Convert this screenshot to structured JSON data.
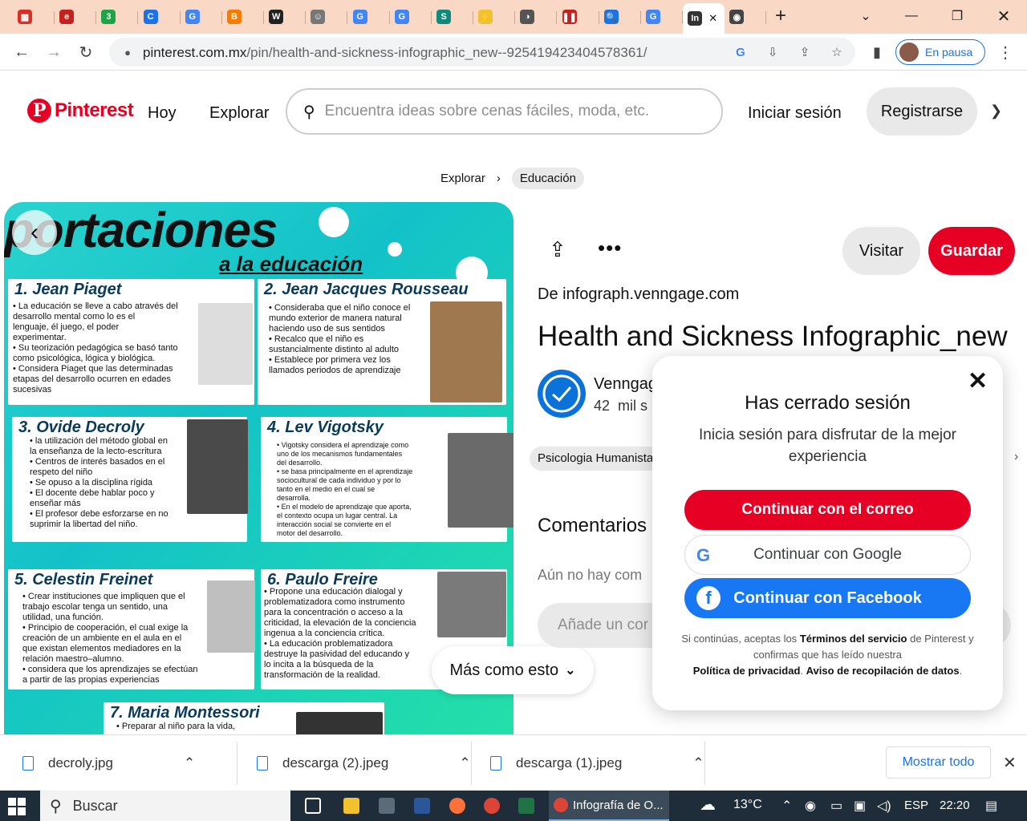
{
  "browser": {
    "tabs": [
      {
        "name": "tab-1",
        "color": "#d93025",
        "glyph": "▦"
      },
      {
        "name": "tab-2",
        "color": "#c5221f",
        "glyph": "e"
      },
      {
        "name": "tab-3",
        "color": "#1ea446",
        "glyph": "3"
      },
      {
        "name": "tab-4",
        "color": "#1a73e8",
        "glyph": "C"
      },
      {
        "name": "tab-5",
        "color": "#4285f4",
        "glyph": "G"
      },
      {
        "name": "tab-6",
        "color": "#f57c00",
        "glyph": "B"
      },
      {
        "name": "tab-7",
        "color": "#222222",
        "glyph": "W"
      },
      {
        "name": "tab-8",
        "color": "#777777",
        "glyph": "☺"
      },
      {
        "name": "tab-9",
        "color": "#4285f4",
        "glyph": "G"
      },
      {
        "name": "tab-10",
        "color": "#4285f4",
        "glyph": "G"
      },
      {
        "name": "tab-11",
        "color": "#0e8a7a",
        "glyph": "S"
      },
      {
        "name": "tab-12",
        "color": "#f2c12e",
        "glyph": "⚡"
      },
      {
        "name": "tab-13",
        "color": "#555555",
        "glyph": "◑"
      },
      {
        "name": "tab-14",
        "color": "#c5221f",
        "glyph": "❚❚"
      },
      {
        "name": "tab-15",
        "color": "#1a73e8",
        "glyph": "🔍"
      },
      {
        "name": "tab-16",
        "color": "#4285f4",
        "glyph": "G"
      },
      {
        "name": "tab-active",
        "color": "#333333",
        "glyph": "In"
      },
      {
        "name": "tab-18",
        "color": "#444444",
        "glyph": "◉"
      }
    ],
    "url_host": "pinterest.com.mx",
    "url_path": "/pin/health-and-sickness-infographic_new--925419423404578361/",
    "profile_label": "En pausa"
  },
  "pinterest": {
    "logo_text": "Pinterest",
    "nav_today": "Hoy",
    "nav_explore": "Explorar",
    "search_placeholder": "Encuentra ideas sobre cenas fáciles, moda, etc.",
    "login": "Iniciar sesión",
    "signup": "Registrarse",
    "breadcrumb": [
      "Explorar",
      "Educación"
    ],
    "more_like_this": "Más como esto",
    "visit": "Visitar",
    "save": "Guardar",
    "source_prefix": "De",
    "source_domain": "infograph.venngage.com",
    "pin_title": "Health and Sickness Infographic_new",
    "author_name": "Venngag",
    "author_followers_num": "42",
    "author_followers_text": "mil s",
    "tag": "Psicologia Humanista",
    "comments_heading": "Comentarios",
    "no_comments": "Aún no hay com",
    "add_comment_placeholder": "Añade un cor"
  },
  "infographic": {
    "title": "portaciones",
    "subtitle": "a la educación",
    "cards": [
      {
        "heading": "1. Jean Piaget",
        "lines": [
          "• La educación se lleve a cabo através del",
          "desarrollo mental como lo es el",
          "lenguaje, él juego, el poder",
          "experimentar.",
          "• Su teorización pedagógica se basó tanto",
          "como psicológica, lógica y biológica.",
          "• Considera Piaget que las determinadas",
          "etapas del desarrollo ocurren en edades",
          "sucesivas"
        ]
      },
      {
        "heading": "2. Jean Jacques Rousseau",
        "lines": [
          "• Consideraba que el niño conoce el",
          "mundo exterior de manera natural",
          "haciendo uso de sus sentidos",
          "• Recalco que el niño es",
          "sustancialmente distinto al adulto",
          "• Establece por primera vez los",
          "llamados periodos de aprendizaje"
        ]
      },
      {
        "heading": "3. Ovide Decroly",
        "lines": [
          "• la utilización del método global en",
          "la enseñanza de la lecto-escritura",
          "• Centros de interés basados en el",
          "respeto del niño",
          "• Se opuso a la disciplina rígida",
          "• El docente debe hablar poco y",
          "enseñar más",
          "• El profesor debe esforzarse en no",
          "suprimir la libertad del niño."
        ]
      },
      {
        "heading": "4. Lev Vigotsky",
        "lines": [
          "• Vigotsky considera el aprendizaje como",
          "uno de los mecanismos fundamentales",
          "del desarrollo.",
          "• se basa principalmente en el aprendizaje",
          "sociocultural de cada individuo y por lo",
          "tanto en el medio en el cual se",
          "desarrolla.",
          "• En el modelo de aprendizaje que aporta,",
          "el contexto ocupa un lugar central. La",
          "interacción social se convierte en el",
          "motor del desarrollo."
        ]
      },
      {
        "heading": "5. Celestin Freinet",
        "lines": [
          "• Crear instituciones que impliquen que el",
          "trabajo escolar tenga un sentido, una",
          "utilidad, una función.",
          "• Principio de cooperación, el cual exige la",
          "creación de un ambiente en el aula en el",
          "que existan elementos mediadores en la",
          "relación maestro–alumno.",
          "• considera que los aprendizajes se efectúan",
          "a partir de las propias experiencias"
        ]
      },
      {
        "heading": "6. Paulo Freire",
        "lines": [
          "• Propone una educación dialogal y",
          "problematizadora como instrumento",
          "para la concentración o acceso a la",
          "criticidad, la elevación de la conciencia",
          "ingenua a la conciencia crítica.",
          "• La educación problematizadora",
          "destruye la pasividad del educando y",
          "lo incita a la búsqueda de la",
          "transformación de la realidad."
        ]
      },
      {
        "heading": "7. Maria Montessori",
        "lines": [
          "• Preparar al niño para la vida,"
        ]
      }
    ]
  },
  "modal": {
    "title": "Has cerrado sesión",
    "subtitle": "Inicia sesión para disfrutar de la mejor experiencia",
    "btn_email": "Continuar con el correo",
    "btn_google": "Continuar con Google",
    "btn_facebook": "Continuar con Facebook",
    "terms_1": "Si continúas, aceptas los",
    "terms_link1": "Términos del servicio",
    "terms_2": "de Pinterest y confirmas que has leído nuestra",
    "terms_link2": "Política de privacidad",
    "terms_link3": "Aviso de recopilación de datos"
  },
  "downloads": {
    "items": [
      "decroly.jpg",
      "descarga (2).jpeg",
      "descarga (1).jpeg"
    ],
    "show_all": "Mostrar todo"
  },
  "taskbar": {
    "search": "Buscar",
    "active_app": "Infografía de O...",
    "temperature": "13°C",
    "language": "ESP",
    "time": "22:20"
  },
  "colors": {
    "pinterest_red": "#e60023",
    "facebook_blue": "#1877f2",
    "tab_strip": "#f9d8c6"
  }
}
